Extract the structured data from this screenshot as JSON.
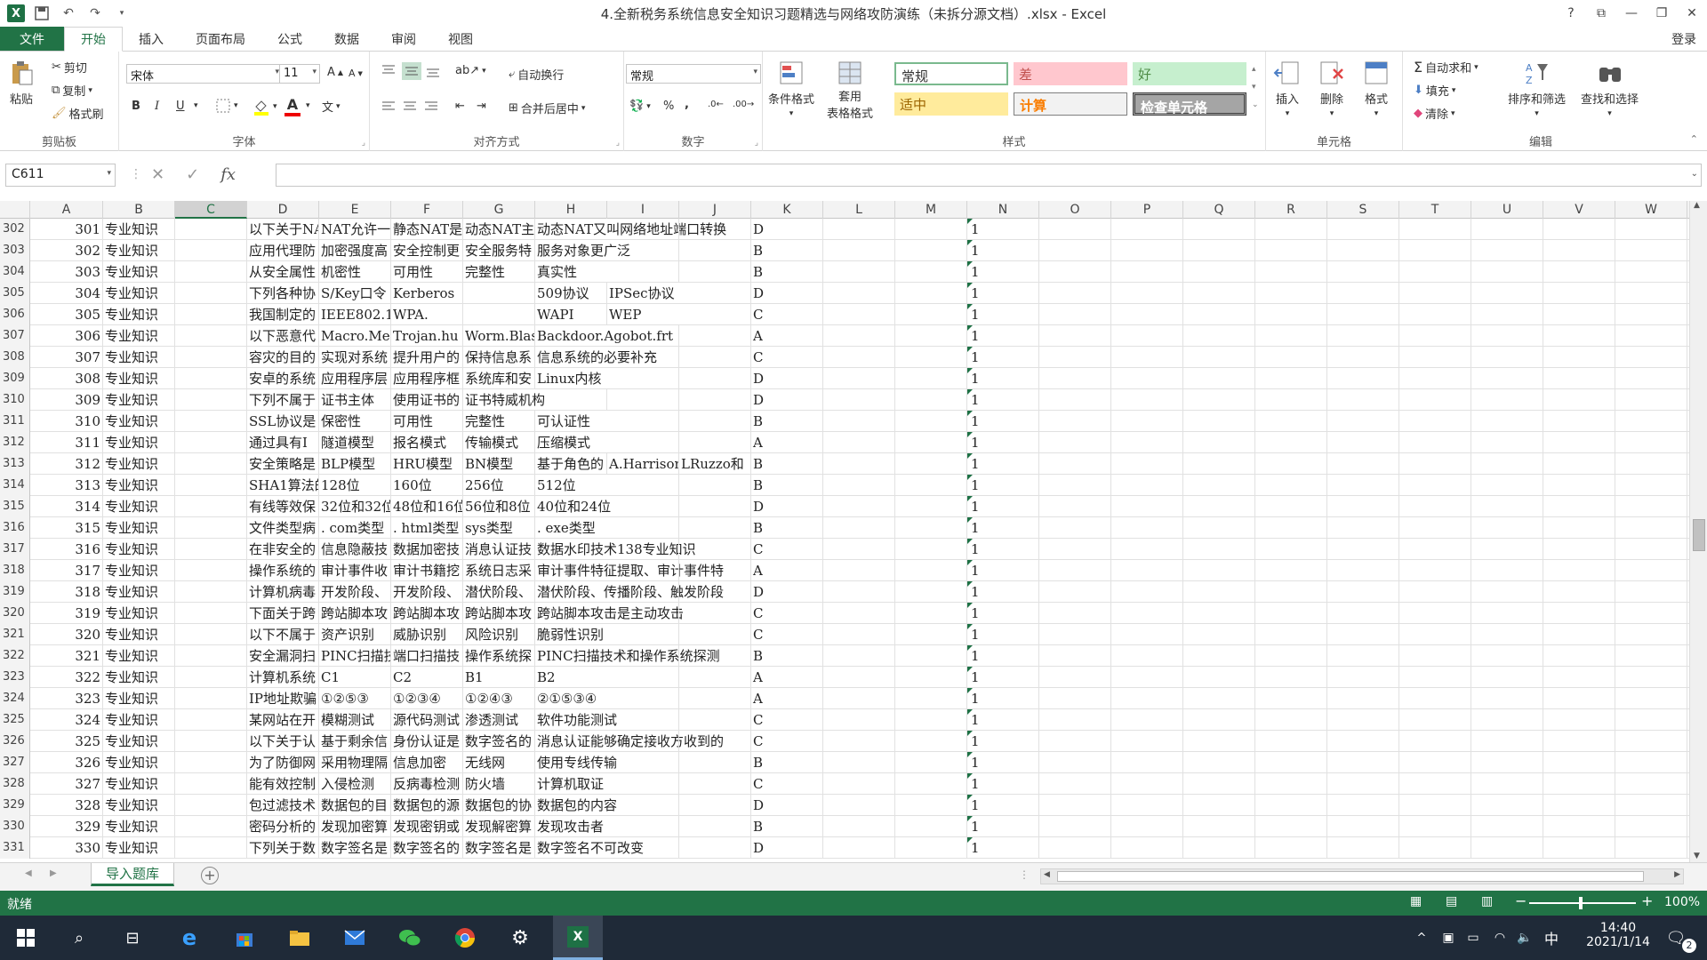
{
  "window": {
    "title": "4.全新税务系统信息安全知识习题精选与网络攻防演练（未拆分源文档）.xlsx - Excel",
    "help": "?",
    "login": "登录"
  },
  "tabs": [
    "文件",
    "开始",
    "插入",
    "页面布局",
    "公式",
    "数据",
    "审阅",
    "视图"
  ],
  "ribbon": {
    "clipboard": {
      "paste": "粘贴",
      "cut": "剪切",
      "copy": "复制",
      "format_painter": "格式刷",
      "label": "剪贴板"
    },
    "font": {
      "name": "宋体",
      "size": "11",
      "bold": "B",
      "italic": "I",
      "underline": "U",
      "label": "字体"
    },
    "alignment": {
      "wrap": "自动换行",
      "merge": "合并后居中",
      "label": "对齐方式"
    },
    "number": {
      "format": "常规",
      "label": "数字",
      "percent": "%",
      "comma": ","
    },
    "styles": {
      "conditional": "条件格式",
      "table_format_1": "套用",
      "table_format_2": "表格格式",
      "cells": [
        {
          "text": "常规",
          "bg": "#ffffff",
          "fg": "#333333"
        },
        {
          "text": "差",
          "bg": "#ffc7ce",
          "fg": "#c0504d"
        },
        {
          "text": "好",
          "bg": "#c6efce",
          "fg": "#4f8c46"
        },
        {
          "text": "适中",
          "bg": "#ffeb9c",
          "fg": "#9c6500"
        },
        {
          "text": "计算",
          "bg": "#f2f2f2",
          "fg": "#fa7d00"
        },
        {
          "text": "检查单元格",
          "bg": "#a5a5a5",
          "fg": "#ffffff"
        }
      ],
      "label": "样式"
    },
    "cells_group": {
      "insert": "插入",
      "delete": "删除",
      "format": "格式",
      "label": "单元格"
    },
    "editing": {
      "autosum": "自动求和",
      "fill": "填充",
      "clear": "清除",
      "sort": "排序和筛选",
      "find": "查找和选择",
      "label": "编辑"
    }
  },
  "formula_bar": {
    "name_box": "C611",
    "fx": "fx",
    "value": ""
  },
  "columns": [
    "A",
    "B",
    "C",
    "D",
    "E",
    "F",
    "G",
    "H",
    "I",
    "J",
    "K",
    "L",
    "M",
    "N",
    "O",
    "P",
    "Q",
    "R",
    "S",
    "T",
    "U",
    "V",
    "W"
  ],
  "selected_column": "C",
  "rows": [
    {
      "r": "302",
      "a": "301",
      "b": "专业知识",
      "d": "以下关于NAT允许一",
      "e": "NAT允许一",
      "f": "静态NAT是",
      "g": "动态NAT主",
      "h": "动态NAT又叫网络地址端口转换",
      "i": "",
      "j": "",
      "k": "D",
      "n": "1"
    },
    {
      "r": "303",
      "a": "302",
      "b": "专业知识",
      "d": "应用代理防",
      "e": "加密强度高",
      "f": "安全控制更",
      "g": "安全服务特",
      "h": "服务对象更广泛",
      "i": "",
      "j": "",
      "k": "B",
      "n": "1"
    },
    {
      "r": "304",
      "a": "303",
      "b": "专业知识",
      "d": "从安全属性",
      "e": "机密性",
      "f": "可用性",
      "g": "完整性",
      "h": "真实性",
      "i": "",
      "j": "",
      "k": "B",
      "n": "1"
    },
    {
      "r": "305",
      "a": "304",
      "b": "专业知识",
      "d": "下列各种协",
      "e": "S/Key口令",
      "f": "Kerberos",
      "g": "",
      "h": "509协议",
      "i": "IPSec协议",
      "j": "",
      "k": "D",
      "n": "1"
    },
    {
      "r": "306",
      "a": "305",
      "b": "专业知识",
      "d": "我国制定的",
      "e": "IEEE802.1",
      "f": "WPA.",
      "g": "",
      "h": "WAPI",
      "i": "WEP",
      "j": "",
      "k": "C",
      "n": "1"
    },
    {
      "r": "307",
      "a": "306",
      "b": "专业知识",
      "d": "以下恶意代",
      "e": "Macro.Mel",
      "f": "Trojan.hu",
      "g": "Worm.Blas",
      "h": "Backdoor.Agobot.frt",
      "i": "",
      "j": "",
      "k": "A",
      "n": "1"
    },
    {
      "r": "308",
      "a": "307",
      "b": "专业知识",
      "d": "容灾的目的",
      "e": "实现对系统",
      "f": "提升用户的",
      "g": "保持信息系",
      "h": "信息系统的必要补充",
      "i": "",
      "j": "",
      "k": "C",
      "n": "1"
    },
    {
      "r": "309",
      "a": "308",
      "b": "专业知识",
      "d": "安卓的系统",
      "e": "应用程序层",
      "f": "应用程序框",
      "g": "系统库和安",
      "h": "Linux内核",
      "i": "",
      "j": "",
      "k": "D",
      "n": "1"
    },
    {
      "r": "310",
      "a": "309",
      "b": "专业知识",
      "d": "下列不属于",
      "e": "证书主体",
      "f": "使用证书的",
      "g": "证书特威机构",
      "h": "",
      "i": "",
      "j": "",
      "k": "D",
      "n": "1"
    },
    {
      "r": "311",
      "a": "310",
      "b": "专业知识",
      "d": "SSL协议是",
      "e": "保密性",
      "f": "可用性",
      "g": "完整性",
      "h": "可认证性",
      "i": "",
      "j": "",
      "k": "B",
      "n": "1"
    },
    {
      "r": "312",
      "a": "311",
      "b": "专业知识",
      "d": "通过具有I",
      "e": "隧道模型",
      "f": "报名模式",
      "g": "传输模式",
      "h": "压缩模式",
      "i": "",
      "j": "",
      "k": "A",
      "n": "1"
    },
    {
      "r": "313",
      "a": "312",
      "b": "专业知识",
      "d": "安全策略是",
      "e": "BLP模型",
      "f": "HRU模型",
      "g": "BN模型",
      "h": "基于角色的",
      "i": "A.Harrison",
      "j": "LRuzzo和",
      "k": "B",
      "n": "1"
    },
    {
      "r": "314",
      "a": "313",
      "b": "专业知识",
      "d": "SHA1算法的",
      "e": "128位",
      "f": "160位",
      "g": "256位",
      "h": "512位",
      "i": "",
      "j": "",
      "k": "B",
      "n": "1"
    },
    {
      "r": "315",
      "a": "314",
      "b": "专业知识",
      "d": "有线等效保",
      "e": "32位和32位",
      "f": "48位和16位",
      "g": "56位和8位",
      "h": "40位和24位",
      "i": "",
      "j": "",
      "k": "D",
      "n": "1"
    },
    {
      "r": "316",
      "a": "315",
      "b": "专业知识",
      "d": "文件类型病",
      "e": ". com类型",
      "f": ". html类型",
      "g": "sys类型",
      ".h": "",
      "h": ". exe类型",
      "i": "",
      "j": "",
      "k": "B",
      "n": "1"
    },
    {
      "r": "317",
      "a": "316",
      "b": "专业知识",
      "d": "在非安全的",
      "e": "信息隐蔽技",
      "f": "数据加密技",
      "g": "消息认证技",
      "h": "数据水印技术138专业知识",
      "i": "",
      "j": "",
      "k": "C",
      "n": "1"
    },
    {
      "r": "318",
      "a": "317",
      "b": "专业知识",
      "d": "操作系统的",
      "e": "审计事件收",
      "f": "审计书籍挖",
      "g": "系统日志采",
      "h": "审计事件特征提取、审计事件特",
      "i": "",
      "j": "",
      "k": "A",
      "n": "1"
    },
    {
      "r": "319",
      "a": "318",
      "b": "专业知识",
      "d": "计算机病毒",
      "e": "开发阶段、",
      "f": "开发阶段、",
      "g": "潜伏阶段、",
      "h": "潜伏阶段、传播阶段、触发阶段",
      "i": "",
      "j": "",
      "k": "D",
      "n": "1"
    },
    {
      "r": "320",
      "a": "319",
      "b": "专业知识",
      "d": "下面关于跨",
      "e": "跨站脚本攻",
      "f": "跨站脚本攻",
      "g": "跨站脚本攻",
      "h": "跨站脚本攻击是主动攻击",
      "i": "",
      "j": "",
      "k": "C",
      "n": "1"
    },
    {
      "r": "321",
      "a": "320",
      "b": "专业知识",
      "d": "以下不属于",
      "e": "资产识别",
      "f": "威胁识别",
      "g": "风险识别",
      "h": "脆弱性识别",
      "i": "",
      "j": "",
      "k": "C",
      "n": "1"
    },
    {
      "r": "322",
      "a": "321",
      "b": "专业知识",
      "d": "安全漏洞扫",
      "e": "PINC扫描技",
      "f": "端口扫描技",
      "g": "操作系统探",
      "h": "PINC扫描技术和操作系统探测",
      "i": "",
      "j": "",
      "k": "B",
      "n": "1"
    },
    {
      "r": "323",
      "a": "322",
      "b": "专业知识",
      "d": "计算机系统",
      "e": "C1",
      "f": "C2",
      "g": "B1",
      "h": "B2",
      "i": "",
      "j": "",
      "k": "A",
      "n": "1"
    },
    {
      "r": "324",
      "a": "323",
      "b": "专业知识",
      "d": "IP地址欺骗",
      "e": "①②⑤③",
      "f": "①②③④",
      "g": "①②④③",
      "h": "②①⑤③④",
      "i": "",
      "j": "",
      "k": "A",
      "n": "1"
    },
    {
      "r": "325",
      "a": "324",
      "b": "专业知识",
      "d": "某网站在开",
      "e": "模糊测试",
      "f": "源代码测试",
      "g": "渗透测试",
      "h": "软件功能测试",
      "i": "",
      "j": "",
      "k": "C",
      "n": "1"
    },
    {
      "r": "326",
      "a": "325",
      "b": "专业知识",
      "d": "以下关于认",
      "e": "基于剩余信",
      "f": "身份认证是",
      "g": "数字签名的",
      "h": "消息认证能够确定接收方收到的",
      "i": "",
      "j": "",
      "k": "C",
      "n": "1"
    },
    {
      "r": "327",
      "a": "326",
      "b": "专业知识",
      "d": "为了防御网",
      "e": "采用物理隔",
      "f": "信息加密",
      "g": "无线网",
      "h": "使用专线传输",
      "i": "",
      "j": "",
      "k": "B",
      "n": "1"
    },
    {
      "r": "328",
      "a": "327",
      "b": "专业知识",
      "d": "能有效控制",
      "e": "入侵检测",
      "f": "反病毒检测",
      "g": "防火墙",
      "h": "计算机取证",
      "i": "",
      "j": "",
      "k": "C",
      "n": "1"
    },
    {
      "r": "329",
      "a": "328",
      "b": "专业知识",
      "d": "包过滤技术",
      "e": "数据包的目",
      "f": "数据包的源",
      "g": "数据包的协",
      "h": "数据包的内容",
      "i": "",
      "j": "",
      "k": "D",
      "n": "1"
    },
    {
      "r": "330",
      "a": "329",
      "b": "专业知识",
      "d": "密码分析的",
      "e": "发现加密算",
      "f": "发现密钥或",
      "g": "发现解密算",
      "h": "发现攻击者",
      "i": "",
      "j": "",
      "k": "B",
      "n": "1"
    },
    {
      "r": "331",
      "a": "330",
      "b": "专业知识",
      "d": "下列关于数",
      "e": "数字签名是",
      "f": "数字签名的",
      "g": "数字签名是",
      "h": "数字签名不可改变",
      "i": "",
      "j": "",
      "k": "D",
      "n": "1"
    }
  ],
  "sheet": {
    "name": "导入题库"
  },
  "status": {
    "ready": "就绪",
    "zoom": "100%"
  },
  "taskbar": {
    "time": "14:40",
    "date": "2021/1/14",
    "ime": "中",
    "notif_count": "2"
  }
}
